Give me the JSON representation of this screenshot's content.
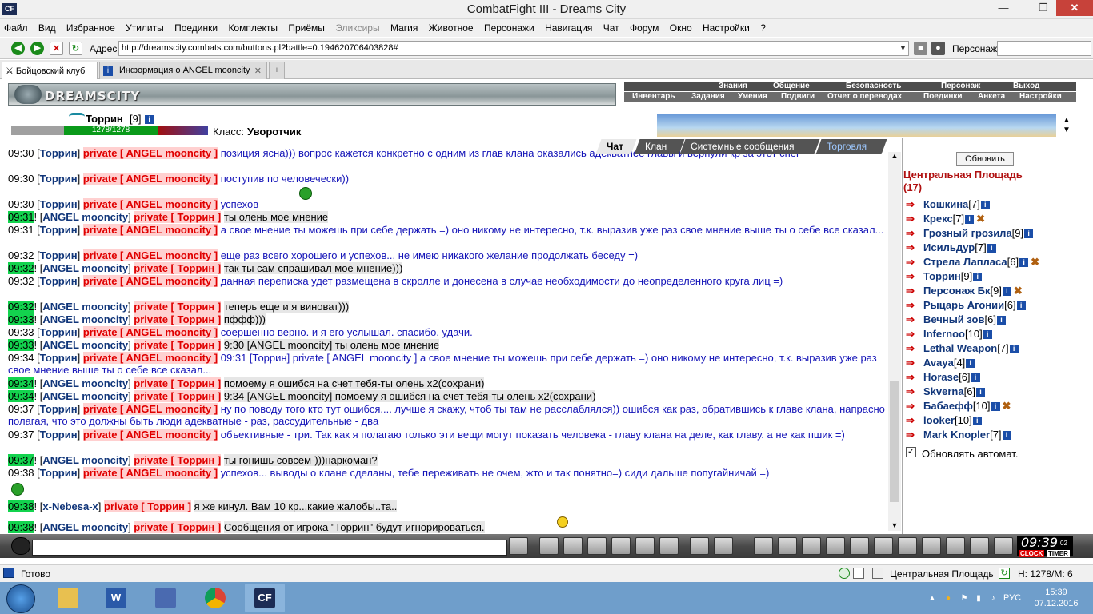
{
  "window": {
    "title": "CombatFight III - Dreams City",
    "appicon": "CF"
  },
  "menu": [
    "Файл",
    "Вид",
    "Избранное",
    "Утилиты",
    "Поединки",
    "Комплекты",
    "Приёмы",
    "Эликсиры",
    "Магия",
    "Животное",
    "Персонажи",
    "Навигация",
    "Чат",
    "Форум",
    "Окно",
    "Настройки",
    "?"
  ],
  "address": {
    "label": "Адрес:",
    "url": "http://dreamscity.combats.com/buttons.pl?battle=0.194620706403828#",
    "persona_label": "Персонаж:"
  },
  "tabs": [
    {
      "label": "Бойцовский клуб"
    },
    {
      "label": "Информация о ANGEL mooncity"
    }
  ],
  "game": {
    "logo": "DREAMSCITY",
    "nav_top": [
      "Знания",
      "Общение",
      "Безопасность",
      "Персонаж",
      "Выход"
    ],
    "nav_bottom": [
      "Инвентарь",
      "Задания",
      "Умения",
      "Подвиги",
      "Отчет о переводах",
      "Поединки",
      "Анкета",
      "Настройки"
    ],
    "char": {
      "name": "Торрин",
      "level": "[9]",
      "hp": "1278/1278",
      "hp_fraction": 1.0,
      "class_label": "Класс:",
      "class_value": "Уворотчик"
    }
  },
  "chat_tabs": [
    "Чат",
    "Клан",
    "Системные сообщения",
    "Торговля"
  ],
  "chat": [
    {
      "time": "09:30",
      "green": false,
      "from": "Торрин",
      "to": "ANGEL mooncity",
      "msg": "позиция ясна))) вопрос кажется конкретно с одним из глав клана",
      "cont": "оказались адекватнее главы и вернули кр за этот снег"
    },
    {
      "time": "09:30",
      "green": false,
      "from": "Торрин",
      "to": "ANGEL mooncity",
      "msg": "поступив по человечески))"
    },
    {
      "time": "09:30",
      "green": false,
      "from": "Торрин",
      "to": "ANGEL mooncity",
      "msg": "успехов"
    },
    {
      "time": "09:31",
      "green": true,
      "from": "ANGEL mooncity",
      "to": "Торрин",
      "msg": "ты олень мое мнение"
    },
    {
      "time": "09:31",
      "green": false,
      "from": "Торрин",
      "to": "ANGEL mooncity",
      "msg": "а свое мнение ты можешь при себе держать =) оно никому не интересно, т.к. выразив уже раз свое мнение выше",
      "cont": "ты о себе все сказал..."
    },
    {
      "time": "09:32",
      "green": false,
      "from": "Торрин",
      "to": "ANGEL mooncity",
      "msg": "еще раз всего хорошего и успехов... не имею никакого желание продолжать беседу =)"
    },
    {
      "time": "09:32",
      "green": true,
      "from": "ANGEL mooncity",
      "to": "Торрин",
      "msg": "так ты сам спрашивал мое мнение)))"
    },
    {
      "time": "09:32",
      "green": false,
      "from": "Торрин",
      "to": "ANGEL mooncity",
      "msg": "данная переписка удет размещена в скролле и донесена в случае необходимости до неопределенного круга лиц",
      "cont": "=)"
    },
    {
      "time": "09:32",
      "green": true,
      "from": "ANGEL mooncity",
      "to": "Торрин",
      "msg": "теперь еще и я виноват)))"
    },
    {
      "time": "09:33",
      "green": true,
      "from": "ANGEL mooncity",
      "to": "Торрин",
      "msg": "пффф)))"
    },
    {
      "time": "09:33",
      "green": false,
      "from": "Торрин",
      "to": "ANGEL mooncity",
      "msg": "соершенно верно. и я его услышал. спасибо. удачи."
    },
    {
      "time": "09:33",
      "green": true,
      "from": "ANGEL mooncity",
      "to": "Торрин",
      "msg": "9:30 [ANGEL mooncity] ты олень мое мнение"
    },
    {
      "time": "09:34",
      "green": false,
      "from": "Торрин",
      "to": "ANGEL mooncity",
      "msg": "09:31 [Торрин] private [ ANGEL mooncity ] а свое мнение ты можешь при себе держать =) оно никому не",
      "cont": "интересно, т.к. выразив уже раз свое мнение выше ты о себе все сказал..."
    },
    {
      "time": "09:34",
      "green": true,
      "from": "ANGEL mooncity",
      "to": "Торрин",
      "msg": "помоему я ошибся на счет тебя-ты олень х2(сохрани)"
    },
    {
      "time": "09:34",
      "green": true,
      "from": "ANGEL mooncity",
      "to": "Торрин",
      "msg": "9:34 [ANGEL mooncity] помоему я ошибся на счет тебя-ты олень х2(сохрани)"
    },
    {
      "time": "09:37",
      "green": false,
      "from": "Торрин",
      "to": "ANGEL mooncity",
      "msg": "ну по поводу того кто тут ошибся.... лучше я скажу, чтоб ты там не расслаблялся)) ошибся как раз,",
      "cont": "обратившись к главе клана, напрасно полагая, что это должны быть люди адекватные - раз, рассудительные - два"
    },
    {
      "time": "09:37",
      "green": false,
      "from": "Торрин",
      "to": "ANGEL mooncity",
      "msg": "объективные - три. Так как я полагаю только эти вещи могут показать человека - главу клана на деле, как",
      "cont": "главу. а не как пшик =)"
    },
    {
      "time": "09:37",
      "green": true,
      "from": "ANGEL mooncity",
      "to": "Торрин",
      "msg": "ты гонишь совсем-)))наркоман?"
    },
    {
      "time": "09:38",
      "green": false,
      "from": "Торрин",
      "to": "ANGEL mooncity",
      "msg": "успехов... выводы о клане сделаны, тебе переживать не очем, жто и так понятно=) сиди дальше попугайничай =)"
    },
    {
      "time": "09:38",
      "green": true,
      "from": "x-Nebesa-x",
      "to": "Торрин",
      "msg": "я же кинул. Вам 10 кр...какие жалобы..та.."
    },
    {
      "time": "09:38",
      "green": true,
      "from": "ANGEL mooncity",
      "to": "Торрин",
      "msg": "Сообщения от игрока \"Торрин\" будут игнорироваться."
    }
  ],
  "sidebar": {
    "refresh": "Обновить",
    "room": "Центральная Площадь",
    "count": "(17)",
    "players": [
      {
        "name": "Кошкина",
        "lvl": "[7]",
        "sword": false
      },
      {
        "name": "Крекс",
        "lvl": "[7]",
        "sword": true
      },
      {
        "name": "Грозный грозила",
        "lvl": "[9]",
        "sword": false
      },
      {
        "name": "Исильдур",
        "lvl": "[7]",
        "sword": false
      },
      {
        "name": "Стрела Лапласа",
        "lvl": "[6]",
        "sword": true
      },
      {
        "name": "Торрин",
        "lvl": "[9]",
        "sword": false
      },
      {
        "name": "Персонаж Бк",
        "lvl": "[9]",
        "sword": true
      },
      {
        "name": "Рыцарь Агонии",
        "lvl": "[6]",
        "sword": false
      },
      {
        "name": "Вечный зов",
        "lvl": "[6]",
        "sword": false
      },
      {
        "name": "Infernoo",
        "lvl": "[10]",
        "sword": false
      },
      {
        "name": "Lethal Weapon",
        "lvl": "[7]",
        "sword": false
      },
      {
        "name": "Avaya",
        "lvl": "[4]",
        "sword": false
      },
      {
        "name": "Horase",
        "lvl": "[6]",
        "sword": false
      },
      {
        "name": "Skverna",
        "lvl": "[6]",
        "sword": false
      },
      {
        "name": "Бабаефф",
        "lvl": "[10]",
        "sword": true
      },
      {
        "name": "looker",
        "lvl": "[10]",
        "sword": false
      },
      {
        "name": "Mark Knopler",
        "lvl": "[7]",
        "sword": false
      }
    ],
    "auto_label": "Обновлять автомат."
  },
  "clock": {
    "time": "09:39",
    "sec": "02",
    "label1": "CLOCK",
    "label2": "TIMER"
  },
  "status": {
    "text": "Готово",
    "room": "Центральная Площадь",
    "hp": "H: 1278/M: 6"
  },
  "tray": {
    "lang": "РУС",
    "time": "15:39",
    "date": "07.12.2016"
  }
}
